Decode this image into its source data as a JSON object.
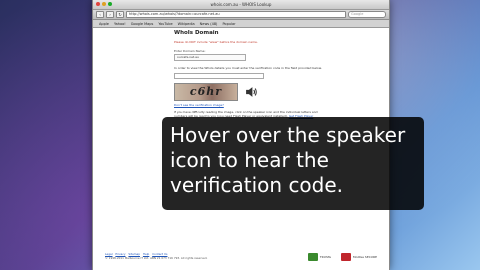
{
  "window": {
    "title": "whois.com.au - WHOIS Lookup"
  },
  "toolbar": {
    "url": "http://whois.com.au/whois/?domain=ourcafe.net.au",
    "search_placeholder": "Google"
  },
  "bookmarks": [
    "Apple",
    "Yahoo!",
    "Google Maps",
    "YouTube",
    "Wikipedia",
    "News (48)",
    "Popular"
  ],
  "page": {
    "title": "WhoIs Domain",
    "warning": "Please do NOT include \"www\" before the domain name.",
    "domain_label": "Enter Domain Name:",
    "domain_value": "ourcafe.net.au",
    "instruction": "In order to view the WhoIs details you must enter the verification code in the field provided below.",
    "captcha_text": "c6hr",
    "verify_link": "Don't see the verification image?",
    "help_text": "If you have difficulty reading the image, click on the speaker icon and the individual letters and numbers will be read to you (you need Flash Player or equivalent installed).",
    "flash_link": "Get Flash Player"
  },
  "footer": {
    "links": [
      "Legal",
      "Privacy",
      "Sitemap",
      "Help",
      "Contact Us"
    ],
    "copyright": "© 1998-2011 Melbourne IT Ltd. ABN 21 073 716 793. All rights reserved.",
    "badge_truste": "TRUSTe",
    "badge_mcafee": "McAfee SECURE"
  },
  "caption": {
    "text": "Hover over the speaker icon to hear the verification code."
  }
}
